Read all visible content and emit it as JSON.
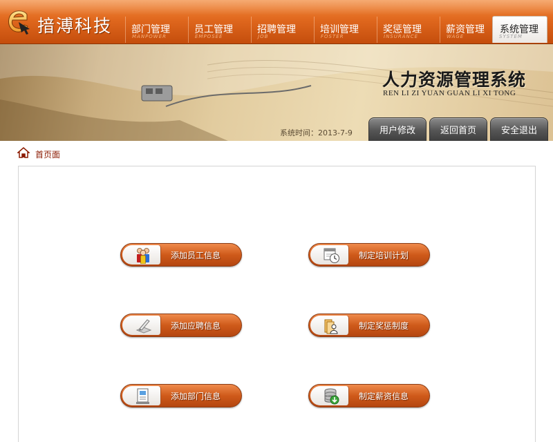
{
  "header": {
    "logo_text": "揞溥科技",
    "nav": [
      {
        "zh": "部门管理",
        "en": "MANPOWER"
      },
      {
        "zh": "员工管理",
        "en": "EMPOSEE"
      },
      {
        "zh": "招聘管理",
        "en": "JOB"
      },
      {
        "zh": "培训管理",
        "en": "FOSTER"
      },
      {
        "zh": "奖惩管理",
        "en": "INSURANCE"
      },
      {
        "zh": "薪资管理",
        "en": "WAGE"
      },
      {
        "zh": "系统管理",
        "en": "SYSTEM"
      }
    ],
    "active_nav": "系统管理"
  },
  "banner": {
    "title": "人力资源管理系统",
    "pinyin": "REN LI ZI YUAN GUAN LI XI TONG",
    "system_time_label": "系统时间：",
    "system_time_value": "2013-7-9",
    "buttons": [
      "用户修改",
      "返回首页",
      "安全退出"
    ]
  },
  "breadcrumb": {
    "label": "首页面"
  },
  "actions": [
    {
      "label": "添加员工信息",
      "icon": "users-icon"
    },
    {
      "label": "制定培训计划",
      "icon": "calendar-clock-icon"
    },
    {
      "label": "添加应聘信息",
      "icon": "edit-pen-icon"
    },
    {
      "label": "制定奖惩制度",
      "icon": "folder-user-icon"
    },
    {
      "label": "添加部门信息",
      "icon": "document-icon"
    },
    {
      "label": "制定薪资信息",
      "icon": "database-download-icon"
    }
  ],
  "colors": {
    "header_orange": "#e0681e",
    "button_orange": "#cf5a1a",
    "breadcrumb_red": "#8b1a00",
    "top_button_gray": "#555555"
  }
}
